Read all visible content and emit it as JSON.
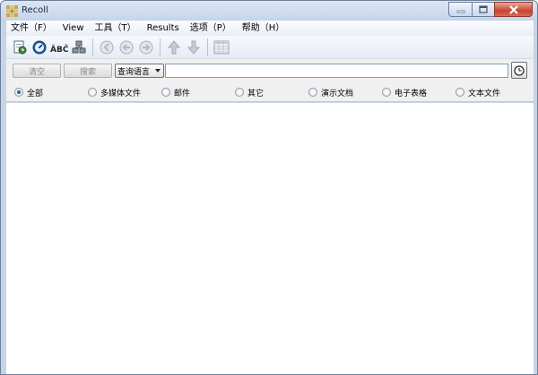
{
  "window": {
    "title": "Recoll",
    "accent": "#c6d4e6",
    "close_color": "#c8432f"
  },
  "menu": {
    "items": [
      {
        "label": "文件（F）"
      },
      {
        "label": "View"
      },
      {
        "label": "工具（T）"
      },
      {
        "label": "Results"
      },
      {
        "label": "选项（P）"
      },
      {
        "label": "帮助（H）"
      }
    ]
  },
  "toolbar": {
    "icons": [
      "document-history-icon",
      "query-dialog-icon",
      "spelling-abc-icon",
      "index-status-icon",
      "first-page-icon",
      "previous-page-icon",
      "next-page-icon",
      "sort-up-icon",
      "sort-down-icon",
      "table-view-icon"
    ],
    "spell_text": "ÂBĈ"
  },
  "search": {
    "clear_label": "清空",
    "search_label": "搜索",
    "language_selected": "查询语言",
    "query_value": ""
  },
  "categories": {
    "items": [
      {
        "label": "全部",
        "checked": true
      },
      {
        "label": "多媒体文件",
        "checked": false
      },
      {
        "label": "邮件",
        "checked": false
      },
      {
        "label": "其它",
        "checked": false
      },
      {
        "label": "演示文档",
        "checked": false
      },
      {
        "label": "电子表格",
        "checked": false
      },
      {
        "label": "文本文件",
        "checked": false
      }
    ]
  }
}
